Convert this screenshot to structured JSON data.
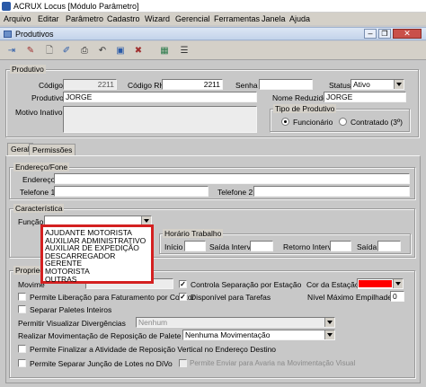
{
  "app": {
    "title": "ACRUX Locus [Módulo Parâmetro]"
  },
  "menu": {
    "items": [
      "Arquivo",
      "Editar",
      "Parâmetro",
      "Cadastro",
      "Wizard",
      "Gerencial",
      "Ferramentas",
      "Janela",
      "Ajuda"
    ]
  },
  "window": {
    "title": "Produtivos"
  },
  "toolbar": {
    "icons": [
      "exit-icon",
      "clear-icon",
      "new-icon",
      "edit-icon",
      "print-icon",
      "cancel-icon",
      "save-icon",
      "delete-icon",
      "calculator-icon",
      "list-icon"
    ]
  },
  "produtivo": {
    "group_title": "Produtivo",
    "codigo_label": "Código",
    "codigo_value": "2211",
    "codigo_rh_label": "Código RH",
    "codigo_rh_value": "2211",
    "senha_label": "Senha",
    "senha_value": "",
    "status_label": "Status",
    "status_value": "Ativo",
    "produtivo_label": "Produtivo",
    "produtivo_value": "JORGE",
    "nome_reduzido_label": "Nome Reduzido",
    "nome_reduzido_value": "JORGE",
    "motivo_inativo_label": "Motivo Inativo",
    "tipo_title": "Tipo de Produtivo",
    "tipo_options": [
      "Funcionário",
      "Contratado (3º)"
    ],
    "tipo_selected": "Funcionário"
  },
  "tabs": [
    "Geral",
    "Permissões"
  ],
  "endereco": {
    "group_title": "Endereço/Fone",
    "endereco_label": "Endereço",
    "telefone1_label": "Telefone 1",
    "telefone2_label": "Telefone 2"
  },
  "caracteristica": {
    "group_title": "Característica",
    "funcao_label": "Função",
    "funcao_value": "",
    "dropdown_options": [
      "AJUDANTE MOTORISTA",
      "AUXILIAR ADMINISTRATIVO",
      "AUXILIAR DE EXPEDIÇÃO",
      "DESCARREGADOR",
      "GERENTE",
      "MOTORISTA",
      "OUTRAS"
    ],
    "horario_title": "Horário Trabalho",
    "inicio_label": "Início",
    "saida_interv_label": "Saída Interv.",
    "retorno_interv_label": "Retorno Interv.",
    "saida_label": "Saída"
  },
  "propriedades": {
    "group_title": "Propried",
    "movimento_label": "Movime",
    "controla_separacao_label": "Controla Separação por Estação",
    "controla_separacao_checked": true,
    "cor_estacao_label": "Cor da Estação",
    "cor_estacao_color": "#ff0000",
    "permite_liberacao_label": "Permite Liberação para Faturamento por Coletor",
    "disponivel_tarefas_label": "Disponível para Tarefas",
    "disponivel_tarefas_checked": true,
    "nivel_maximo_label": "Nível Máximo Empilhadeira",
    "nivel_maximo_value": "0",
    "separar_paletes_label": "Separar Paletes Inteiros",
    "permitir_divergencias_label": "Permitir Visualizar Divergências",
    "permitir_divergencias_value": "Nenhum",
    "realizar_movimentacao_label": "Realizar Movimentação de Reposição de Palete Inteiro",
    "realizar_movimentacao_value": "Nenhuma Movimentação",
    "permite_finalizar_label": "Permite Finalizar a Atividade de Reposição Vertical no Endereço Destino",
    "permite_separar_juncao_label": "Permite Separar Junção de Lotes no DiVo",
    "permite_enviar_avaria_label": "Permite Enviar para Avaria na Movimentação Visual"
  }
}
